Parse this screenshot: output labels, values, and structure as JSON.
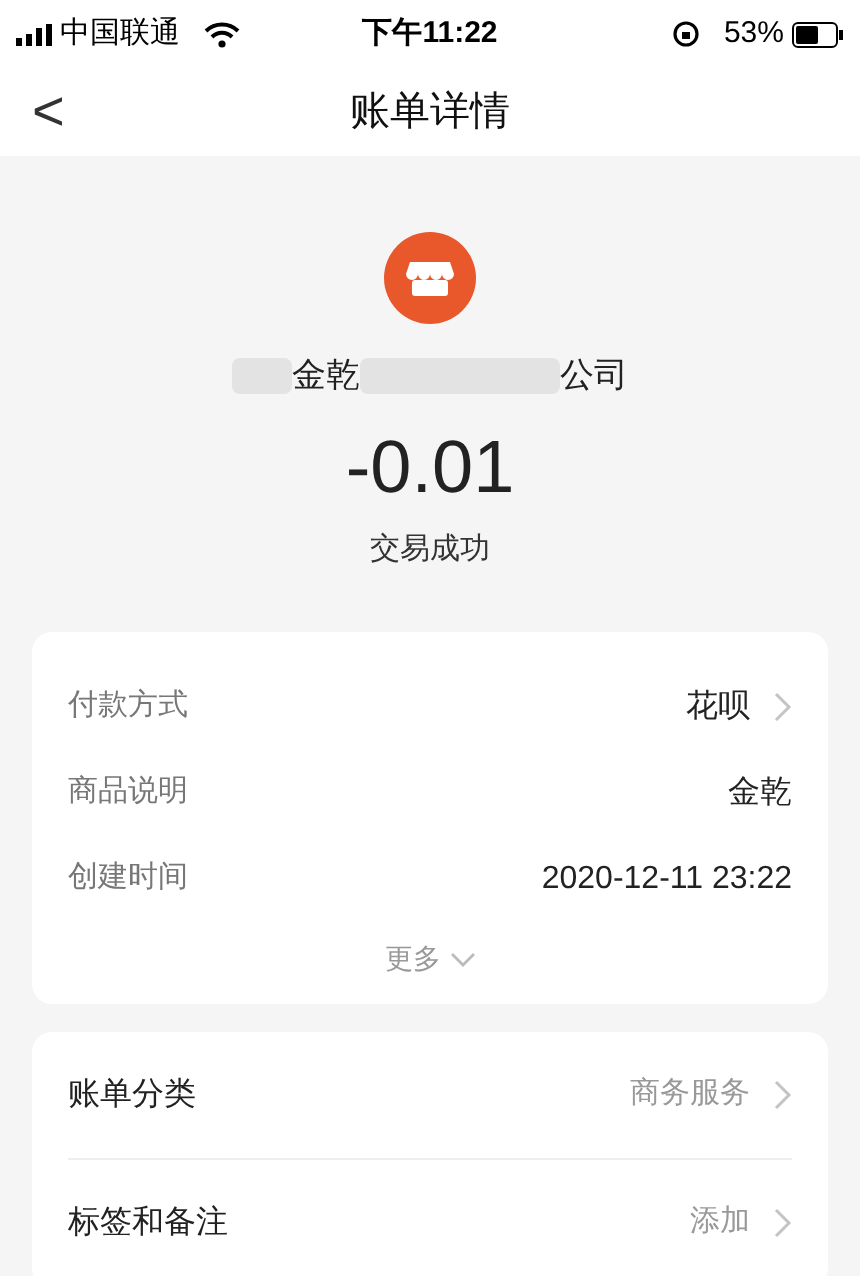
{
  "status_bar": {
    "carrier": "中国联通",
    "time": "下午11:22",
    "battery": "53%"
  },
  "nav": {
    "back": "<",
    "title": "账单详情"
  },
  "merchant": {
    "segments": [
      {
        "kind": "redacted"
      },
      {
        "kind": "text",
        "text": "金乾"
      },
      {
        "kind": "redacted"
      },
      {
        "kind": "text",
        "text": "公司"
      }
    ]
  },
  "amount": "-0.01",
  "status": "交易成功",
  "details": [
    {
      "label": "付款方式",
      "value": "花呗",
      "chevron": true
    },
    {
      "label": "商品说明",
      "value": "金乾",
      "chevron": false
    },
    {
      "label": "创建时间",
      "value": "2020-12-11 23:22",
      "chevron": false
    }
  ],
  "more": "更多",
  "settings": [
    {
      "label": "账单分类",
      "value": "商务服务"
    },
    {
      "label": "标签和备注",
      "value": "添加"
    }
  ]
}
